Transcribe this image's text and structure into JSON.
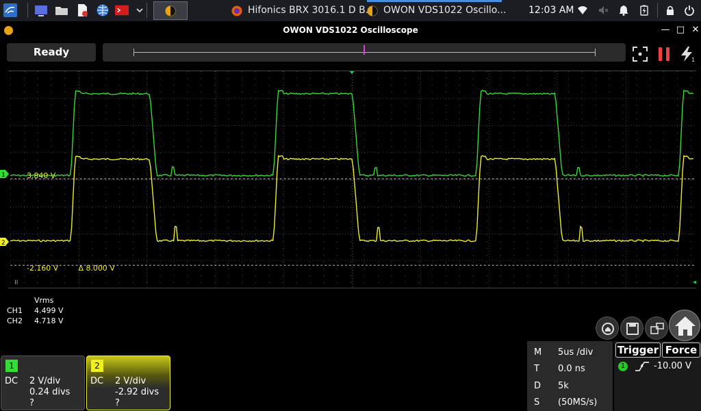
{
  "taskbar": {
    "tasks": [
      {
        "label": "Hifonics BRX 3016.1 D B..."
      },
      {
        "label": "OWON VDS1022 Oscillo..."
      }
    ],
    "clock": "12:03 AM"
  },
  "window": {
    "title": "OWON VDS1022 Oscilloscope"
  },
  "toolbar": {
    "status": "Ready"
  },
  "scope": {
    "ch1_marker": "1",
    "ch2_marker": "2",
    "cursor_upper_label": "3.840 V",
    "cursor_lower_label": "-2.160 V",
    "cursor_delta_label": "Δ 8.000 V",
    "colors": {
      "ch1": "#33dd33",
      "ch2": "#f0f020",
      "trigger_marker": "#22cc66"
    }
  },
  "measurements": {
    "header": "Vrms",
    "rows": [
      {
        "channel": "CH1",
        "value": "4.499 V"
      },
      {
        "channel": "CH2",
        "value": "4.718 V"
      }
    ]
  },
  "channels": [
    {
      "num": "1",
      "coupling": "DC",
      "scale": "2 V/div",
      "offset": "0.24 divs",
      "probe": "?"
    },
    {
      "num": "2",
      "coupling": "DC",
      "scale": "2 V/div",
      "offset": "-2.92 divs",
      "probe": "?"
    }
  ],
  "timebase": {
    "rows": [
      {
        "key": "M",
        "value": "5us /div"
      },
      {
        "key": "T",
        "value": "0.0 ns"
      },
      {
        "key": "D",
        "value": "5k"
      },
      {
        "key": "S",
        "value": "(50MS/s)"
      }
    ]
  },
  "trigger": {
    "trigger_label": "Trigger",
    "force_label": "Force",
    "source": "1",
    "level": "-10.00 V"
  }
}
